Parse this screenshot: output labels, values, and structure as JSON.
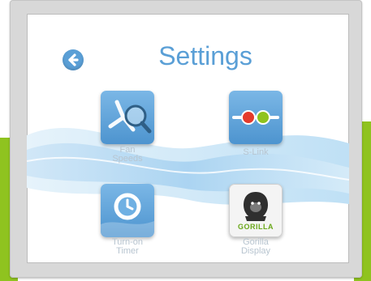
{
  "title": "Settings",
  "icons": {
    "back": "back-arrow-icon"
  },
  "colors": {
    "accent": "#5a9fd6",
    "frame": "#d8d8d8",
    "side_bar": "#8fc31f"
  },
  "settings": [
    {
      "line1": "Fan",
      "line2": "Speeds",
      "icon": "fan-magnifier-icon"
    },
    {
      "line1": "S-Link",
      "line2": "",
      "icon": "link-dots-icon"
    },
    {
      "line1": "Turn-on",
      "line2": "Timer",
      "icon": "clock-icon"
    },
    {
      "line1": "Gorilla",
      "line2": "Display",
      "icon": "gorilla-icon",
      "logo_text": "GORILLA"
    }
  ]
}
